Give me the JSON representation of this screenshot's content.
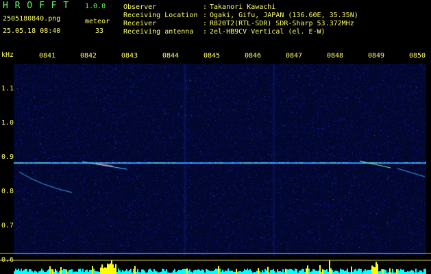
{
  "app": {
    "name": "H R O F F T",
    "version": "1.0.0"
  },
  "file": {
    "filename": "2505180840.png",
    "timestamp": "25.05.18 08:40"
  },
  "meteor": {
    "label": "meteor",
    "count": "33"
  },
  "info": [
    {
      "key": "Observer",
      "sep": ":",
      "value": "Takanori Kawachi"
    },
    {
      "key": "Receiving Location",
      "sep": ":",
      "value": "Ogaki, Gifu, JAPAN (136.60E, 35.35N)"
    },
    {
      "key": "Receiver",
      "sep": ":",
      "value": "R820T2(RTL-SDR) SDR-Sharp 53.372MHz"
    },
    {
      "key": "Receiving antenna",
      "sep": ":",
      "value": "2el-HB9CV Vertical (el. E-W)"
    }
  ],
  "time_ticks": [
    "0841",
    "0842",
    "0843",
    "0844",
    "0845",
    "0846",
    "0847",
    "0848",
    "0849",
    "0850"
  ],
  "freq_axis": {
    "unit": "kHz",
    "labels": [
      "1.1",
      "1.0",
      "0.9",
      "0.8",
      "0.7",
      "0.6"
    ]
  },
  "colors": {
    "title": "#66ff66",
    "text": "#ffff66",
    "background": "#000000",
    "noise": "#0a1078",
    "carrier": "#33ccff",
    "activity": "#00ffff",
    "activity_peak": "#ffff00"
  }
}
